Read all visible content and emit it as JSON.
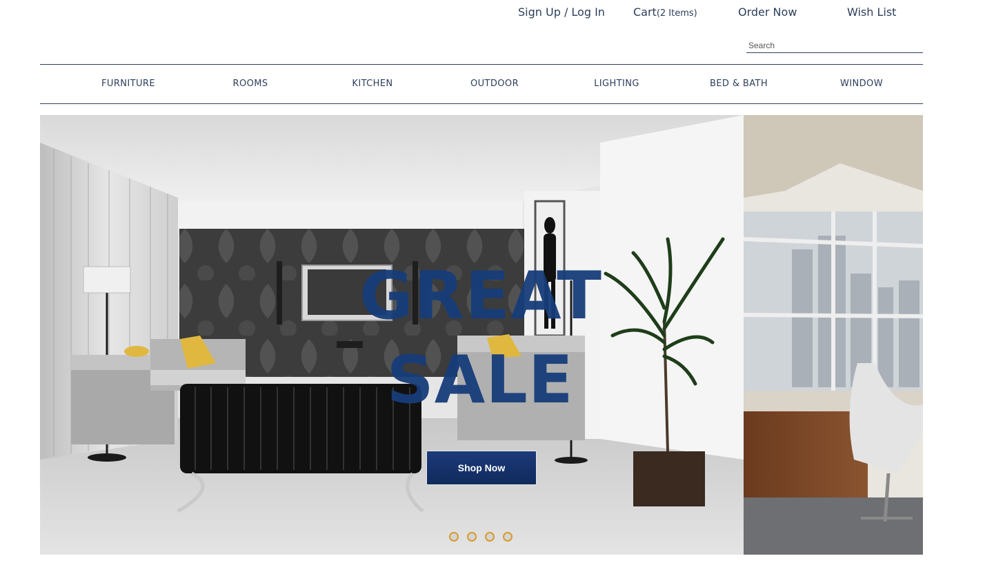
{
  "header": {
    "signup_label": "Sign Up / Log In",
    "cart_label": "Cart",
    "cart_count": "(2 Items)",
    "order_label": "Order Now",
    "wishlist_label": "Wish List"
  },
  "search": {
    "placeholder": "Search",
    "value": ""
  },
  "categories": [
    "FURNITURE",
    "ROOMS",
    "KITCHEN",
    "OUTDOOR",
    "LIGHTING",
    "BED & BATH",
    "WINDOW"
  ],
  "hero": {
    "headline_line1": "GREAT",
    "headline_line2": "SALE",
    "button_label": "Shop Now",
    "slide_count": 4
  },
  "colors": {
    "text": "#2c3e5a",
    "accent": "#173d7a",
    "button": "#102a5c",
    "dot_border": "#d89a2a"
  }
}
